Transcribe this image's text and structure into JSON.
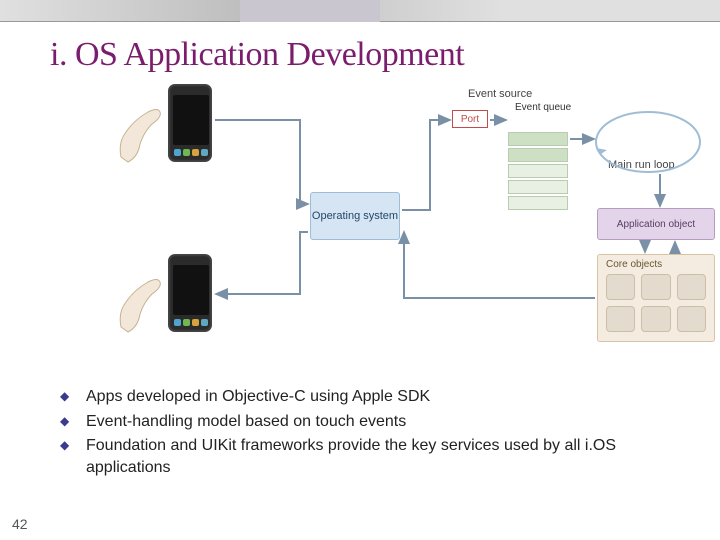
{
  "title": "i. OS Application Development",
  "diagram": {
    "operating_system": "Operating\nsystem",
    "event_source": "Event source",
    "port": "Port",
    "event_queue": "Event\nqueue",
    "main_run_loop": "Main run loop",
    "application_object": "Application object",
    "core_objects": "Core objects"
  },
  "bullets": [
    "Apps developed in Objective-C using Apple SDK",
    "Event-handling model based on touch events",
    "Foundation and UIKit frameworks provide the key services used by all i.OS applications"
  ],
  "page_number": "42"
}
